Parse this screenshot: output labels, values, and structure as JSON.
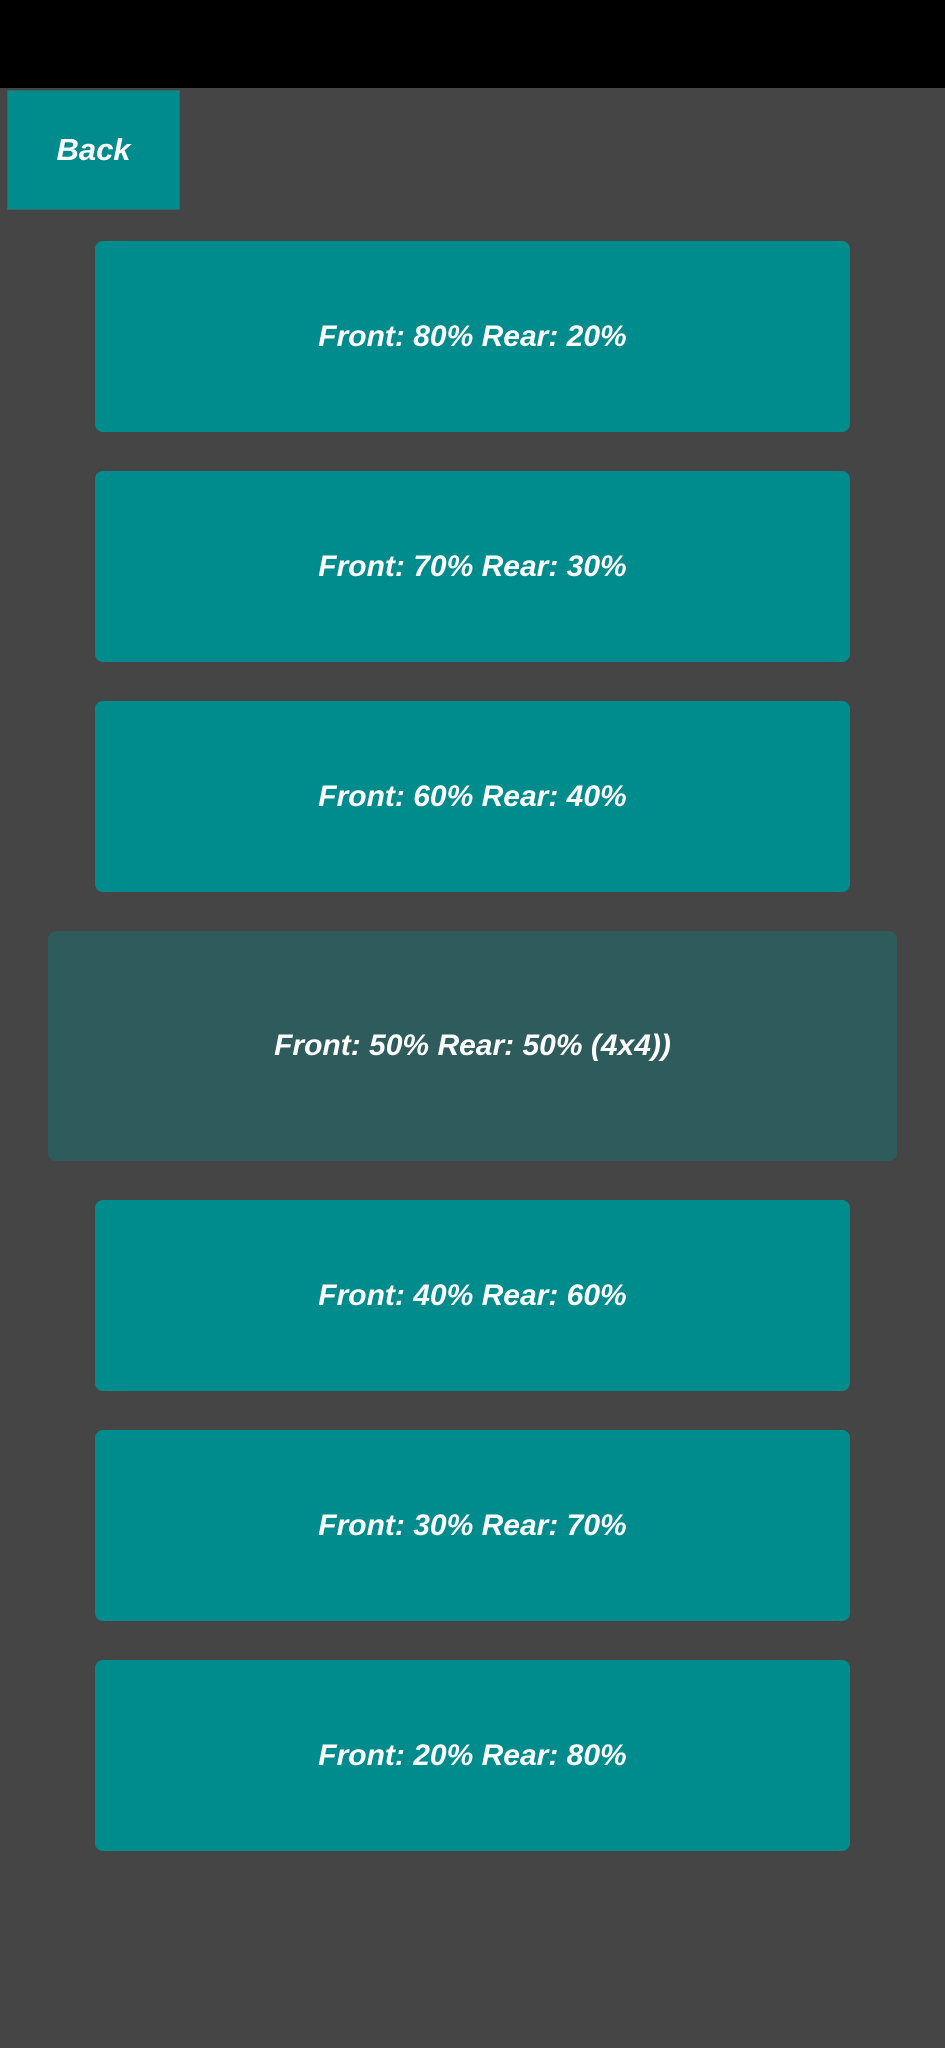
{
  "colors": {
    "background": "#454545",
    "status_bar": "#000000",
    "button": "#008c8c",
    "button_selected": "#2e5b5b",
    "text": "#ffffff"
  },
  "back_button": {
    "label": "Back"
  },
  "torque_split_options": [
    {
      "label": "Front: 80% Rear: 20%",
      "selected": false
    },
    {
      "label": "Front: 70% Rear: 30%",
      "selected": false
    },
    {
      "label": "Front: 60% Rear: 40%",
      "selected": false
    },
    {
      "label": "Front: 50% Rear: 50% (4x4))",
      "selected": true
    },
    {
      "label": "Front: 40% Rear: 60%",
      "selected": false
    },
    {
      "label": "Front: 30% Rear: 70%",
      "selected": false
    },
    {
      "label": "Front: 20% Rear: 80%",
      "selected": false
    }
  ]
}
